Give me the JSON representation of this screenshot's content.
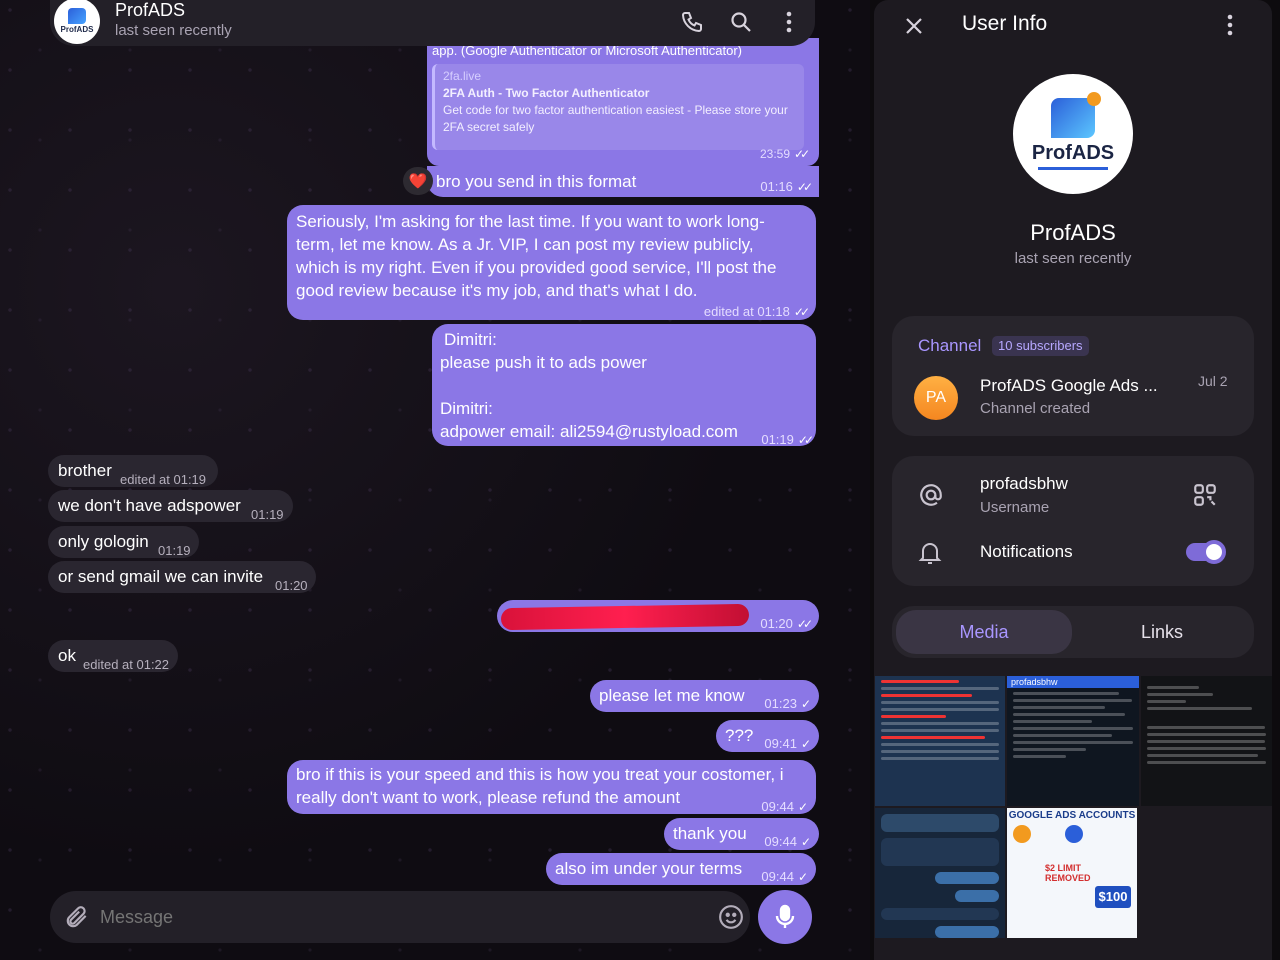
{
  "header": {
    "title": "ProfADS",
    "subtitle": "last seen recently",
    "avatar_text": "ProfADS"
  },
  "preview": {
    "top_text": "app. (Google Authenticator or Microsoft Authenticator)",
    "site": "2fa.live",
    "title": "2FA Auth - Two Factor Authenticator",
    "desc": "Get code for two factor authentication easiest - Please store your 2FA secret safely",
    "time": "23:59"
  },
  "messages": {
    "m1": {
      "text": "bro you send in this format",
      "time": "01:16",
      "reaction": "❤️"
    },
    "m2": {
      "text": "Seriously, I'm asking for the last time. If you want to work long-term, let me know. As a Jr. VIP, I can post my review publicly, which is my right. Even if you provided good service, I'll post the good review because it's my job, and that's what I do.",
      "time": "edited at 01:18"
    },
    "m3": {
      "line1": "Dimitri:",
      "line2": "please push it to ads power",
      "line3": "Dimitri:",
      "line4": "adpower email: ali2594@rustyload.com",
      "time": "01:19"
    },
    "m4": {
      "text": "brother",
      "time": "edited at 01:19"
    },
    "m5": {
      "text": "we don't have adspower",
      "time": "01:19"
    },
    "m6": {
      "text": "only gologin",
      "time": "01:19"
    },
    "m7": {
      "text": "or send gmail we can invite",
      "time": "01:20"
    },
    "m8": {
      "time": "01:20"
    },
    "m9": {
      "text": "ok",
      "time": "edited at 01:22"
    },
    "m10": {
      "text": "please let me know",
      "time": "01:23"
    },
    "m11": {
      "text": "???",
      "time": "09:41"
    },
    "m12": {
      "text": "bro if this is your speed and this is how you treat your costomer, i really don't want to work, please refund the amount",
      "time": "09:44"
    },
    "m13": {
      "text": "thank you",
      "time": "09:44"
    },
    "m14": {
      "text": "also im under your terms",
      "time": "09:44"
    }
  },
  "composer": {
    "placeholder": "Message"
  },
  "panel": {
    "title": "User Info",
    "name": "ProfADS",
    "status": "last seen recently",
    "channel_label": "Channel",
    "subscribers": "10 subscribers",
    "channel_avatar": "PA",
    "channel_name": "ProfADS Google Ads ...",
    "channel_sub": "Channel created",
    "channel_date": "Jul 2",
    "username": "profadsbhw",
    "username_label": "Username",
    "notifications_label": "Notifications",
    "notifications_on": true,
    "tabs": [
      "Media",
      "Links"
    ]
  },
  "media": {
    "t2_title": "profadsbhw",
    "t5_title": "GOOGLE ADS ACCOUNTS",
    "t5_price": "$100",
    "t5_limit": "$2 LIMIT REMOVED"
  },
  "colors": {
    "accent": "#8b77e6",
    "panel": "#1d1a20",
    "card": "#28252c"
  }
}
